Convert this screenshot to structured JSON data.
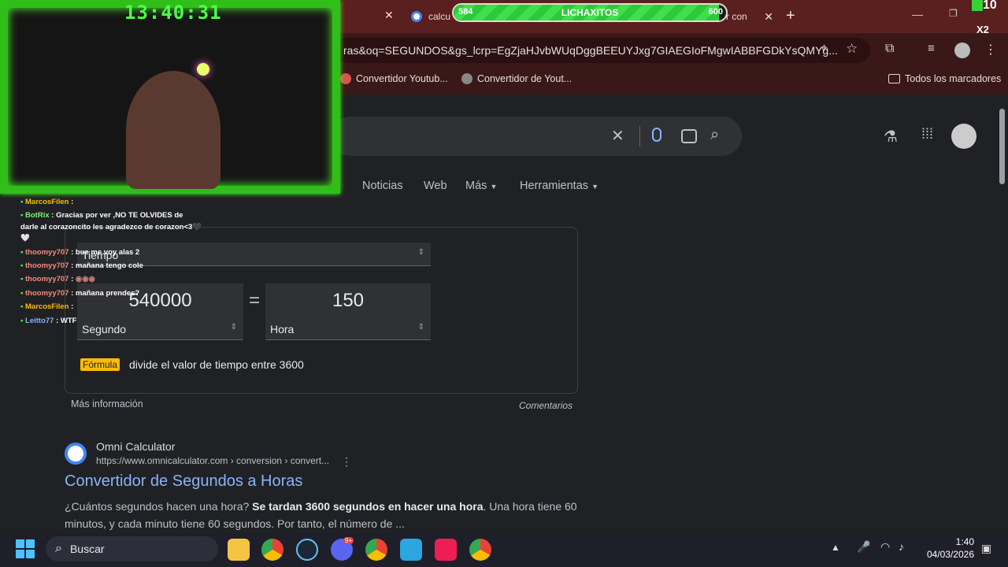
{
  "browser": {
    "tabs": [
      {
        "label": "calcu"
      },
      {
        "label": "r con"
      }
    ],
    "new_tab": "+",
    "url": "ras&oq=SEGUNDOS&gs_lcrp=EgZjaHJvbWUqDggBEEUYJxg7GIAEGIoFMgwIABBFGDkYsQMYg...",
    "bookmarks": [
      {
        "label": "Convertidor Youtub..."
      },
      {
        "label": "Convertidor de Yout..."
      }
    ],
    "all_bookmarks": "Todos los marcadores"
  },
  "google": {
    "nav_tabs": [
      "Noticias",
      "Web",
      "Más",
      "Herramientas"
    ],
    "converter": {
      "category": "Tiempo",
      "from_value": "540000",
      "equals": "=",
      "to_value": "150",
      "from_unit": "Segundo",
      "to_unit": "Hora",
      "formula_badge": "Fórmula",
      "formula_text": "divide el valor de tiempo entre 3600"
    },
    "more_info": "Más información",
    "feedback": "Comentarios",
    "result": {
      "site": "Omni Calculator",
      "url": "https://www.omnicalculator.com › conversion › convert...",
      "title": "Convertidor de Segundos a Horas",
      "snippet_part1": "¿Cuántos segundos hacen una hora? ",
      "snippet_bold": "Se tardan 3600 segundos en hacer una hora",
      "snippet_part2": ". Una hora tiene 60",
      "snippet_line2": "minutos, y cada minuto tiene 60 segundos. Por tanto, el número de ..."
    }
  },
  "overlay": {
    "clock": "13:40:31",
    "goal": {
      "current": "584",
      "name": "LICHAXITOS",
      "target": "600",
      "progress": 0.973
    },
    "multiplier": "10",
    "multiplier2": "X2",
    "chat": [
      {
        "user": "MarcosFilen",
        "msg": " : "
      },
      {
        "user": "BotRix",
        "msg": " : Gracias por ver ,NO TE OLVIDES de"
      },
      {
        "user": "",
        "msg": "darle al corazoncito les agradezco de corazon<3🖤"
      },
      {
        "user": "",
        "msg": "🤍"
      },
      {
        "user": "thoomyy707",
        "msg": " : bue me voy alas 2"
      },
      {
        "user": "thoomyy707",
        "msg": " : mañana tengo cole"
      },
      {
        "user": "thoomyy707",
        "msg": " : "
      },
      {
        "user": "thoomyy707",
        "msg": " : mañana prendes?"
      },
      {
        "user": "MarcosFilen",
        "msg": " : "
      },
      {
        "user": "Leitto77",
        "msg": " : WTF"
      }
    ]
  },
  "taskbar": {
    "search": "Buscar",
    "time": "1:40",
    "date": "04/03/2026",
    "discord_badge": "9+"
  }
}
